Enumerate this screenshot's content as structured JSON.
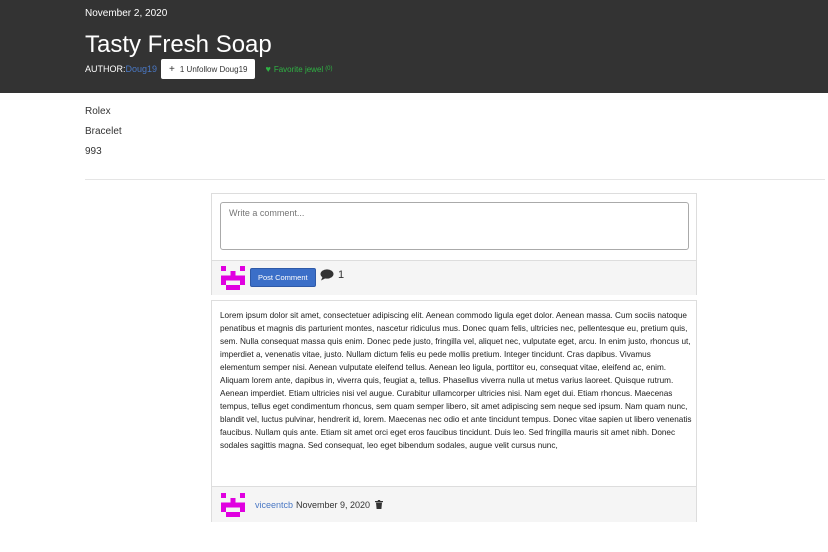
{
  "header": {
    "date": "November 2, 2020",
    "title": "Tasty Fresh Soap",
    "author_label": "AUTHOR:",
    "author_name": "Doug19",
    "unfollow_label": "1 Unfollow Doug19",
    "favorite_label": "Favorite jewel",
    "favorite_count": "(0)"
  },
  "tags": [
    "Rolex",
    "Bracelet",
    "993"
  ],
  "comment_form": {
    "placeholder": "Write a comment...",
    "post_label": "Post Comment",
    "comment_count": "1"
  },
  "comments": [
    {
      "text": "Lorem ipsum dolor sit amet, consectetuer adipiscing elit. Aenean commodo ligula eget dolor. Aenean massa. Cum sociis natoque penatibus et magnis dis parturient montes, nascetur ridiculus mus. Donec quam felis, ultricies nec, pellentesque eu, pretium quis, sem. Nulla consequat massa quis enim. Donec pede justo, fringilla vel, aliquet nec, vulputate eget, arcu. In enim justo, rhoncus ut, imperdiet a, venenatis vitae, justo. Nullam dictum felis eu pede mollis pretium. Integer tincidunt. Cras dapibus. Vivamus elementum semper nisi. Aenean vulputate eleifend tellus. Aenean leo ligula, porttitor eu, consequat vitae, eleifend ac, enim. Aliquam lorem ante, dapibus in, viverra quis, feugiat a, tellus. Phasellus viverra nulla ut metus varius laoreet. Quisque rutrum. Aenean imperdiet. Etiam ultricies nisi vel augue. Curabitur ullamcorper ultricies nisi. Nam eget dui. Etiam rhoncus. Maecenas tempus, tellus eget condimentum rhoncus, sem quam semper libero, sit amet adipiscing sem neque sed ipsum. Nam quam nunc, blandit vel, luctus pulvinar, hendrerit id, lorem. Maecenas nec odio et ante tincidunt tempus. Donec vitae sapien ut libero venenatis faucibus. Nullam quis ante. Etiam sit amet orci eget eros faucibus tincidunt. Duis leo. Sed fringilla mauris sit amet nibh. Donec sodales sagittis magna. Sed consequat, leo eget bibendum sodales, augue velit cursus nunc,",
      "user": "viceentcb",
      "date": "November 9, 2020"
    }
  ],
  "colors": {
    "header_bg": "#333333",
    "link": "#4a78c4",
    "favorite": "#2fb344",
    "post_button": "#3b6fc8",
    "avatar": "#e000e0"
  },
  "icons": [
    "plus-icon",
    "heart-icon",
    "comment-bubble-icon",
    "trash-icon",
    "identicon-avatar"
  ]
}
